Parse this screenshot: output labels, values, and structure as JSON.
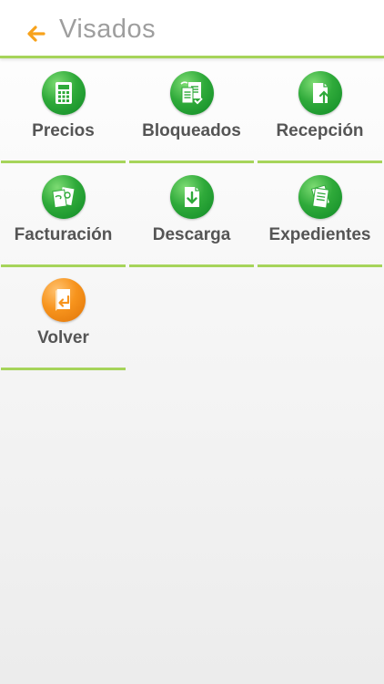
{
  "header": {
    "title": "Visados",
    "back_icon": "arrow-left-icon",
    "accent_color": "#f7a21b"
  },
  "theme": {
    "divider_color": "#a6d45a",
    "icon_green": "#2faa3a",
    "icon_orange": "#f7941d",
    "label_color": "#555555"
  },
  "menu": {
    "items": [
      {
        "label": "Precios",
        "icon": "calculator-icon",
        "color": "green"
      },
      {
        "label": "Bloqueados",
        "icon": "documents-lock-icon",
        "color": "green"
      },
      {
        "label": "Recepción",
        "icon": "receive-document-icon",
        "color": "green"
      },
      {
        "label": "Facturación",
        "icon": "invoice-icon",
        "color": "green"
      },
      {
        "label": "Descarga",
        "icon": "download-icon",
        "color": "green"
      },
      {
        "label": "Expedientes",
        "icon": "files-icon",
        "color": "green"
      },
      {
        "label": "Volver",
        "icon": "return-icon",
        "color": "orange"
      }
    ]
  }
}
